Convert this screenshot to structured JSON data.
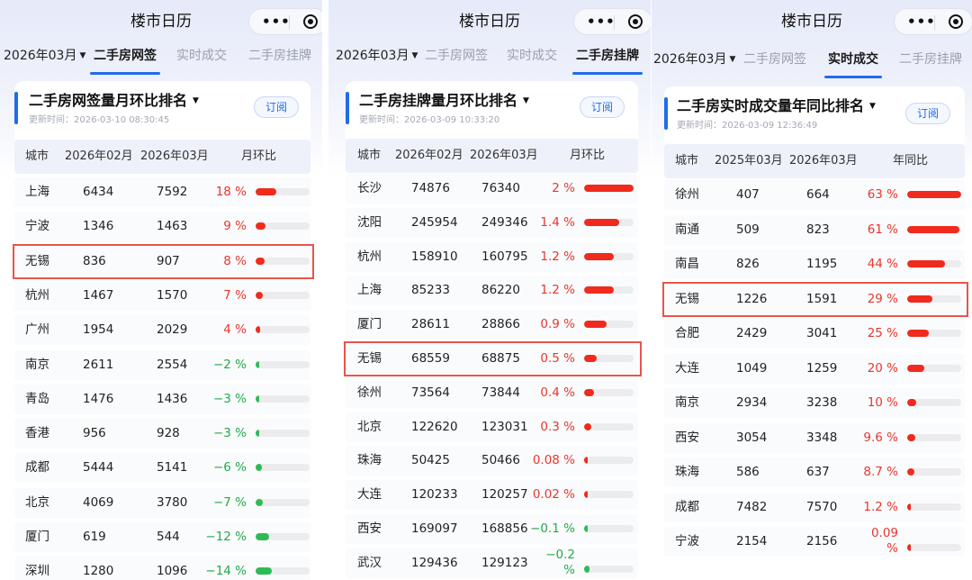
{
  "app_title": "楼市日历",
  "subscribe_label": "订阅",
  "tabs": [
    "二手房网签",
    "实时成交",
    "二手房挂牌"
  ],
  "month_selector": "2026年03月",
  "colors": {
    "accent": "#1f6ce8",
    "up": "#e8372c",
    "down": "#24a94a",
    "highlight": "#e8544c"
  },
  "panels": [
    {
      "title": "二手房网签量月环比排名",
      "update_time": "更新时间：2026-03-10 08:30:45",
      "active_tab": 0,
      "columns": [
        "城市",
        "2026年02月",
        "2026年03月",
        "月环比"
      ],
      "highlight_city": "无锡",
      "rows": [
        {
          "city": "上海",
          "prev": "6434",
          "curr": "7592",
          "change": "18 %",
          "dir": "up",
          "bar": 0.38
        },
        {
          "city": "宁波",
          "prev": "1346",
          "curr": "1463",
          "change": "9 %",
          "dir": "up",
          "bar": 0.19
        },
        {
          "city": "无锡",
          "prev": "836",
          "curr": "907",
          "change": "8 %",
          "dir": "up",
          "bar": 0.17
        },
        {
          "city": "杭州",
          "prev": "1467",
          "curr": "1570",
          "change": "7 %",
          "dir": "up",
          "bar": 0.14
        },
        {
          "city": "广州",
          "prev": "1954",
          "curr": "2029",
          "change": "4 %",
          "dir": "up",
          "bar": 0.08
        },
        {
          "city": "南京",
          "prev": "2611",
          "curr": "2554",
          "change": "−2 %",
          "dir": "down",
          "bar": 0.04
        },
        {
          "city": "青岛",
          "prev": "1476",
          "curr": "1436",
          "change": "−3 %",
          "dir": "down",
          "bar": 0.06
        },
        {
          "city": "香港",
          "prev": "956",
          "curr": "928",
          "change": "−3 %",
          "dir": "down",
          "bar": 0.06
        },
        {
          "city": "成都",
          "prev": "5444",
          "curr": "5141",
          "change": "−6 %",
          "dir": "down",
          "bar": 0.12
        },
        {
          "city": "北京",
          "prev": "4069",
          "curr": "3780",
          "change": "−7 %",
          "dir": "down",
          "bar": 0.14
        },
        {
          "city": "厦门",
          "prev": "619",
          "curr": "544",
          "change": "−12 %",
          "dir": "down",
          "bar": 0.25
        },
        {
          "city": "深圳",
          "prev": "1280",
          "curr": "1096",
          "change": "−14 %",
          "dir": "down",
          "bar": 0.3
        }
      ]
    },
    {
      "title": "二手房挂牌量月环比排名",
      "update_time": "更新时间：2026-03-09 10:33:20",
      "active_tab": 2,
      "columns": [
        "城市",
        "2026年02月",
        "2026年03月",
        "月环比"
      ],
      "highlight_city": "无锡",
      "rows": [
        {
          "city": "长沙",
          "prev": "74876",
          "curr": "76340",
          "change": "2 %",
          "dir": "up",
          "bar": 1.0
        },
        {
          "city": "沈阳",
          "prev": "245954",
          "curr": "249346",
          "change": "1.4 %",
          "dir": "up",
          "bar": 0.7
        },
        {
          "city": "杭州",
          "prev": "158910",
          "curr": "160795",
          "change": "1.2 %",
          "dir": "up",
          "bar": 0.6
        },
        {
          "city": "上海",
          "prev": "85233",
          "curr": "86220",
          "change": "1.2 %",
          "dir": "up",
          "bar": 0.6
        },
        {
          "city": "厦门",
          "prev": "28611",
          "curr": "28866",
          "change": "0.9 %",
          "dir": "up",
          "bar": 0.45
        },
        {
          "city": "无锡",
          "prev": "68559",
          "curr": "68875",
          "change": "0.5 %",
          "dir": "up",
          "bar": 0.25
        },
        {
          "city": "徐州",
          "prev": "73564",
          "curr": "73844",
          "change": "0.4 %",
          "dir": "up",
          "bar": 0.2
        },
        {
          "city": "北京",
          "prev": "122620",
          "curr": "123031",
          "change": "0.3 %",
          "dir": "up",
          "bar": 0.15
        },
        {
          "city": "珠海",
          "prev": "50425",
          "curr": "50466",
          "change": "0.08 %",
          "dir": "up",
          "bar": 0.04
        },
        {
          "city": "大连",
          "prev": "120233",
          "curr": "120257",
          "change": "0.02 %",
          "dir": "up",
          "bar": 0.01
        },
        {
          "city": "西安",
          "prev": "169097",
          "curr": "168856",
          "change": "−0.1 %",
          "dir": "down",
          "bar": 0.05
        },
        {
          "city": "武汉",
          "prev": "129436",
          "curr": "129123",
          "change": "−0.2 %",
          "dir": "down",
          "bar": 0.1,
          "wrap": true
        }
      ]
    },
    {
      "title": "二手房实时成交量年同比排名",
      "update_time": "更新时间：2026-03-09 12:36:49",
      "active_tab": 1,
      "columns": [
        "城市",
        "2025年03月",
        "2026年03月",
        "年同比"
      ],
      "highlight_city": "无锡",
      "rows": [
        {
          "city": "徐州",
          "prev": "407",
          "curr": "664",
          "change": "63 %",
          "dir": "up",
          "bar": 1.0
        },
        {
          "city": "南通",
          "prev": "509",
          "curr": "823",
          "change": "61 %",
          "dir": "up",
          "bar": 0.97
        },
        {
          "city": "南昌",
          "prev": "826",
          "curr": "1195",
          "change": "44 %",
          "dir": "up",
          "bar": 0.7
        },
        {
          "city": "无锡",
          "prev": "1226",
          "curr": "1591",
          "change": "29 %",
          "dir": "up",
          "bar": 0.46
        },
        {
          "city": "合肥",
          "prev": "2429",
          "curr": "3041",
          "change": "25 %",
          "dir": "up",
          "bar": 0.4
        },
        {
          "city": "大连",
          "prev": "1049",
          "curr": "1259",
          "change": "20 %",
          "dir": "up",
          "bar": 0.32
        },
        {
          "city": "南京",
          "prev": "2934",
          "curr": "3238",
          "change": "10 %",
          "dir": "up",
          "bar": 0.16
        },
        {
          "city": "西安",
          "prev": "3054",
          "curr": "3348",
          "change": "9.6 %",
          "dir": "up",
          "bar": 0.15
        },
        {
          "city": "珠海",
          "prev": "586",
          "curr": "637",
          "change": "8.7 %",
          "dir": "up",
          "bar": 0.14
        },
        {
          "city": "成都",
          "prev": "7482",
          "curr": "7570",
          "change": "1.2 %",
          "dir": "up",
          "bar": 0.02
        },
        {
          "city": "宁波",
          "prev": "2154",
          "curr": "2156",
          "change": "0.09 %",
          "dir": "up",
          "bar": 0.0,
          "wrap": true
        }
      ]
    }
  ]
}
